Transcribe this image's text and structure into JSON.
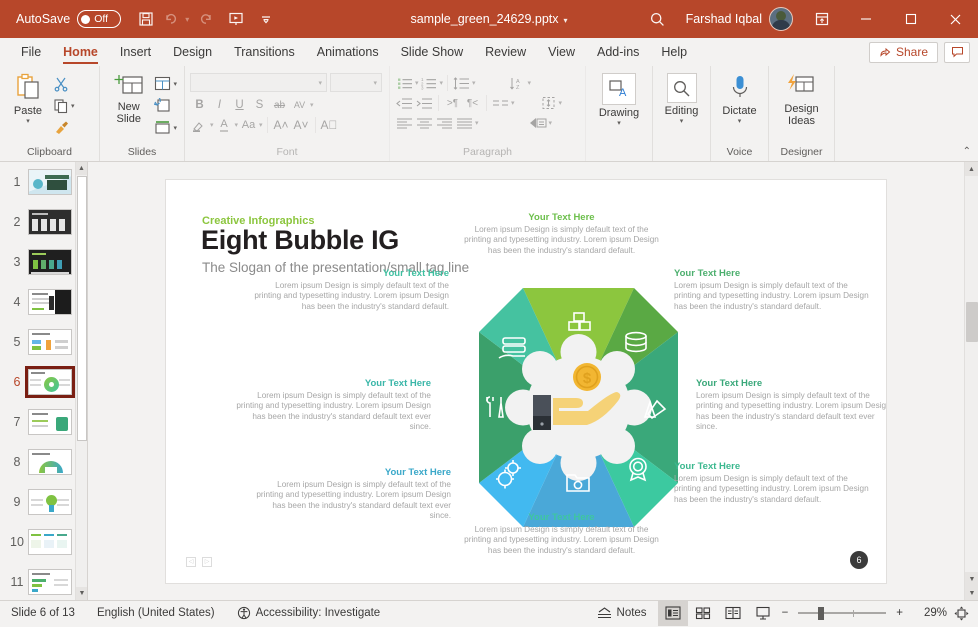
{
  "titlebar": {
    "autosave_label": "AutoSave",
    "autosave_state": "Off",
    "save_icon": "save-icon",
    "undo_icon": "undo-icon",
    "redo_icon": "redo-icon",
    "present_icon": "start-presentation-icon",
    "customize_icon": "customize-quick-access-icon",
    "filename": "sample_green_24629.pptx",
    "search_icon": "search-icon",
    "user_name": "Farshad Iqbal",
    "ribbon_display_icon": "ribbon-display-options-icon",
    "minimize": "—",
    "maximize": "□",
    "close": "✕"
  },
  "tabs": [
    {
      "label": "File",
      "active": false
    },
    {
      "label": "Home",
      "active": true
    },
    {
      "label": "Insert",
      "active": false
    },
    {
      "label": "Design",
      "active": false
    },
    {
      "label": "Transitions",
      "active": false
    },
    {
      "label": "Animations",
      "active": false
    },
    {
      "label": "Slide Show",
      "active": false
    },
    {
      "label": "Review",
      "active": false
    },
    {
      "label": "View",
      "active": false
    },
    {
      "label": "Add-ins",
      "active": false
    },
    {
      "label": "Help",
      "active": false
    }
  ],
  "tabs_right": {
    "share_label": "Share",
    "share_icon": "share-icon",
    "comments_icon": "comments-icon"
  },
  "ribbon": {
    "clipboard": {
      "name": "Clipboard",
      "paste_label": "Paste",
      "cut_label": "Cut",
      "copy_label": "Copy",
      "format_painter_label": "Format Painter"
    },
    "slides": {
      "name": "Slides",
      "new_slide_label": "New Slide",
      "layout_label": "Layout",
      "reset_label": "Reset",
      "section_label": "Section"
    },
    "font": {
      "name": "Font",
      "font_name_value": "",
      "font_size_value": "",
      "bold": "B",
      "italic": "I",
      "underline": "U",
      "shadow": "S",
      "strikethrough": "ab",
      "spacing": "AV",
      "highlight": "text-highlight-icon",
      "font_color": "A",
      "change_case": "Aa",
      "grow_font": "A",
      "shrink_font": "A",
      "clear_formatting": "A"
    },
    "paragraph": {
      "name": "Paragraph",
      "bullets": "bullets-icon",
      "numbering": "numbering-icon",
      "line_spacing": "line-spacing-icon",
      "text_direction_sort": "sort-icon",
      "decrease_indent": "decrease-indent-icon",
      "increase_indent": "increase-indent-icon",
      "ltr": "left-to-right-icon",
      "rtl": "right-to-left-icon",
      "columns": "columns-icon",
      "align_text": "align-text-icon",
      "align_left": "align-left-icon",
      "align_center": "align-center-icon",
      "align_right": "align-right-icon",
      "justify": "justify-icon",
      "smartart": "convert-to-smartart-icon"
    },
    "drawing": {
      "name": "Drawing",
      "label": "Drawing",
      "icon": "drawing-shapes-icon"
    },
    "editing": {
      "name": "Editing",
      "label": "Editing",
      "icon": "find-magnifier-icon"
    },
    "voice": {
      "name": "Voice",
      "label": "Dictate",
      "icon": "microphone-icon"
    },
    "designer": {
      "name": "Designer",
      "label": "Design Ideas",
      "icon": "design-ideas-icon"
    },
    "collapse_icon": "collapse-ribbon-icon"
  },
  "thumbnails": {
    "slides": [
      {
        "number": "1",
        "selected": false
      },
      {
        "number": "2",
        "selected": false
      },
      {
        "number": "3",
        "selected": false
      },
      {
        "number": "4",
        "selected": false
      },
      {
        "number": "5",
        "selected": false
      },
      {
        "number": "6",
        "selected": true
      },
      {
        "number": "7",
        "selected": false
      },
      {
        "number": "8",
        "selected": false
      },
      {
        "number": "9",
        "selected": false
      },
      {
        "number": "10",
        "selected": false
      },
      {
        "number": "11",
        "selected": false
      }
    ],
    "scroll_up_icon": "scroll-up-arrow-icon",
    "scroll_down_icon": "scroll-down-arrow-icon"
  },
  "slide": {
    "kicker": "Creative Infographics",
    "title": "Eight Bubble IG",
    "subtitle": "The Slogan of the presentation/small tag line",
    "slide_number_badge": "6",
    "nav_prev": "◁",
    "nav_next": "▷",
    "body_3line": "Lorem ipsum Design is simply default text of the printing and typesetting industry. Lorem ipsum Design has been the industry's standard default.",
    "body_4line": "Lorem ipsum Design is simply default text of the printing and typesetting industry. Lorem ipsum Design has been the industry's standard default text ever since.",
    "callouts": [
      {
        "heading": "Your Text Here",
        "color": "#6cbf4b",
        "align": "center",
        "body": "Lorem ipsum Design is simply default text of the printing and typesetting industry. Lorem ipsum Design has been the industry's standard default."
      },
      {
        "heading": "Your Text Here",
        "color": "#4caf6e",
        "align": "left",
        "body": "Lorem ipsum Design is simply default text of the printing and typesetting industry. Lorem ipsum Design has been the industry's standard default."
      },
      {
        "heading": "Your Text Here",
        "color": "#3aa87a",
        "align": "left",
        "body": "Lorem ipsum Design is simply default text of the printing and typesetting industry. Lorem ipsum Design has been the industry's standard default text ever since."
      },
      {
        "heading": "Your Text Here",
        "color": "#3cb88f",
        "align": "left",
        "body": "Lorem ipsum Design is simply default text of the printing and typesetting industry. Lorem ipsum Design has been the industry's standard default."
      },
      {
        "heading": "Your Text Here",
        "color": "#3ec6a0",
        "align": "center",
        "body": "Lorem ipsum Design is simply default text of the printing and typesetting industry. Lorem ipsum Design has been the industry's standard default."
      },
      {
        "heading": "Your Text Here",
        "color": "#3aa8c9",
        "align": "right",
        "body": "Lorem ipsum Design is simply default text of the printing and typesetting industry. Lorem ipsum Design has been the industry's standard default text ever since."
      },
      {
        "heading": "Your Text Here",
        "color": "#39b6a8",
        "align": "right",
        "body": "Lorem ipsum Design is simply default text of the printing and typesetting industry. Lorem ipsum Design has been the industry's standard default text ever since."
      },
      {
        "heading": "Your Text Here",
        "color": "#3fbfa0",
        "align": "right",
        "body": "Lorem ipsum Design is simply default text of the printing and typesetting industry. Lorem ipsum Design has been the industry's standard default."
      }
    ],
    "wheel": {
      "segments": [
        {
          "name": "boxes",
          "color": "#8cc63e",
          "icon": "stacked-boxes-icon"
        },
        {
          "name": "coins",
          "color": "#5aa944",
          "icon": "coin-stack-icon"
        },
        {
          "name": "tools",
          "color": "#3aa87a",
          "icon": "pen-ruler-icon"
        },
        {
          "name": "award",
          "color": "#3cc9a0",
          "icon": "award-ribbon-icon"
        },
        {
          "name": "folder",
          "color": "#4aa8d8",
          "icon": "folder-settings-icon"
        },
        {
          "name": "gears",
          "color": "#42b9f0",
          "icon": "gears-icon"
        },
        {
          "name": "wrench",
          "color": "#3ba06b",
          "icon": "wrench-screwdriver-icon"
        },
        {
          "name": "server",
          "color": "#45c2a0",
          "icon": "server-hand-icon"
        }
      ],
      "center_icon": "hand-holding-coin-icon",
      "center_coin_color": "#f2b632",
      "center_hand_color": "#f5d277"
    }
  },
  "status": {
    "slide_counter": "Slide 6 of 13",
    "language": "English (United States)",
    "accessibility": "Accessibility: Investigate",
    "accessibility_icon": "accessibility-icon",
    "notes_label": "Notes",
    "notes_icon": "notes-icon",
    "view_normal": "normal-view-icon",
    "view_sorter": "slide-sorter-icon",
    "view_reading": "reading-view-icon",
    "view_slideshow": "slideshow-view-icon",
    "zoom_out": "−",
    "zoom_in": "+",
    "zoom_level": "29%",
    "fit_slide_icon": "fit-slide-to-window-icon"
  }
}
